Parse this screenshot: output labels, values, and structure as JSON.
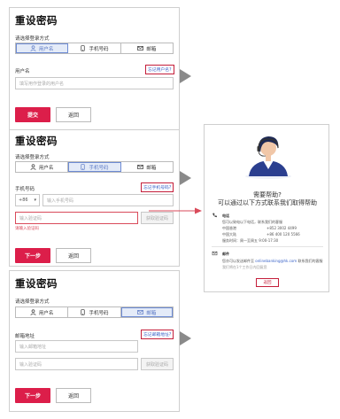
{
  "panel1": {
    "title": "重设密码",
    "method_label": "请选择登录方式",
    "tabs": [
      {
        "label": "用户名",
        "icon": "user-icon",
        "active": true
      },
      {
        "label": "手机号码",
        "icon": "phone-icon",
        "active": false
      },
      {
        "label": "邮箱",
        "icon": "mail-icon",
        "active": false
      }
    ],
    "field_label": "用户名",
    "forgot_link": "忘记用户名?",
    "input_placeholder": "填写用作登录的用户名",
    "submit": "提交",
    "back": "返回"
  },
  "panel2": {
    "title": "重设密码",
    "method_label": "请选择登录方式",
    "tabs": [
      {
        "label": "用户名",
        "icon": "user-icon",
        "active": false
      },
      {
        "label": "手机号码",
        "icon": "phone-icon",
        "active": true
      },
      {
        "label": "邮箱",
        "icon": "mail-icon",
        "active": false
      }
    ],
    "field_label": "手机号码",
    "forgot_link": "忘记手机号码?",
    "country_code": "+86",
    "phone_placeholder": "输入手机号码",
    "sms_placeholder": "输入验证码",
    "sms_button": "获取验证码",
    "error": "请输入验证码",
    "next": "下一步",
    "back": "返回"
  },
  "panel3": {
    "title": "重设密码",
    "method_label": "请选择登录方式",
    "tabs": [
      {
        "label": "用户名",
        "icon": "user-icon",
        "active": false
      },
      {
        "label": "手机号码",
        "icon": "phone-icon",
        "active": false
      },
      {
        "label": "邮箱",
        "icon": "mail-icon",
        "active": true
      }
    ],
    "field_label": "邮箱地址",
    "forgot_link": "忘记邮箱地址?",
    "email_placeholder": "输入邮箱地址",
    "code_placeholder": "输入验证码",
    "code_button": "获取验证码",
    "next": "下一步",
    "back": "返回"
  },
  "help": {
    "title_line1": "需要帮助?",
    "title_line2": "可以通过以下方式联系我们取得帮助",
    "phone_label": "电话",
    "phone_desc": "您可以致电以下电话，联系我们的客服",
    "phone_rows": [
      {
        "region": "中国香港",
        "number": "+852 3002 4499"
      },
      {
        "region": "中国大陆",
        "number": "+86 400 120 5566"
      }
    ],
    "hours": "服务时间：周一至周五 9:00-17:30",
    "email_label": "邮件",
    "email_desc": "您亦可以发送邮件至",
    "email_addr": "onlinebanking@hk.com",
    "email_tail": "联系我们的客服",
    "reply_note": "我们将在1个工作日内回复您",
    "back": "返回"
  },
  "colors": {
    "primary": "#dc1e4a",
    "link": "#3a63c8",
    "highlight": "#c41e3a",
    "tab_active_bg": "#e4ebf8"
  }
}
